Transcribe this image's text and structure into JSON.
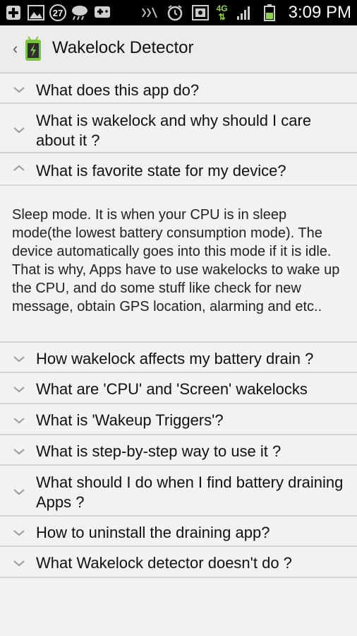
{
  "status_bar": {
    "notification_count": "27",
    "network": "4G",
    "time": "3:09 PM",
    "icons": [
      "add-icon",
      "image-icon",
      "weather-rain-icon",
      "game-icon",
      "mute-icon",
      "alarm-icon",
      "screenshot-icon",
      "signal-icon",
      "battery-icon"
    ]
  },
  "app_bar": {
    "title": "Wakelock Detector",
    "logo": "battery-android-icon"
  },
  "faq": [
    {
      "question": "What does this app do?",
      "expanded": false
    },
    {
      "question": "What is wakelock and why should I care about it ?",
      "expanded": false
    },
    {
      "question": "What is favorite state for my device?",
      "expanded": true,
      "answer": "Sleep mode. It is when your CPU is in sleep mode(the lowest battery consumption mode). The device automatically goes into this mode if it is idle. That is why, Apps have to use wakelocks to wake up the CPU, and do some stuff like check for new message, obtain GPS location, alarming and etc.."
    },
    {
      "question": "How wakelock affects my battery drain ?",
      "expanded": false
    },
    {
      "question": "What are 'CPU' and 'Screen' wakelocks",
      "expanded": false
    },
    {
      "question": "What is 'Wakeup Triggers'?",
      "expanded": false
    },
    {
      "question": "What is step-by-step way to use it ?",
      "expanded": false
    },
    {
      "question": "What should I do when I find battery draining Apps ?",
      "expanded": false
    },
    {
      "question": "How to uninstall the draining app?",
      "expanded": false
    },
    {
      "question": "What Wakelock detector doesn't do ?",
      "expanded": false
    }
  ],
  "colors": {
    "status_bar_bg": "#000000",
    "app_bar_bg": "#ececec",
    "page_bg": "#f2f2f2",
    "divider": "#d2d2d2",
    "chevron": "#9a9a9a",
    "logo_green": "#7cc242"
  }
}
